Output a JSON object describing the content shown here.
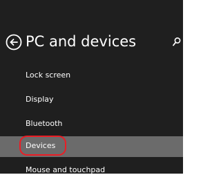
{
  "header": {
    "title": "PC and devices",
    "back_icon": "back-arrow-circle-icon",
    "search_icon": "search-icon"
  },
  "nav": {
    "items": [
      {
        "label": "Lock screen",
        "selected": false
      },
      {
        "label": "Display",
        "selected": false
      },
      {
        "label": "Bluetooth",
        "selected": false
      },
      {
        "label": "Devices",
        "selected": true
      },
      {
        "label": "Mouse and touchpad",
        "selected": false
      }
    ]
  },
  "colors": {
    "panel_background": "#1f1f1f",
    "selected_background": "#6b6b6b",
    "text": "#ffffff",
    "annotation": "#ec1c24"
  }
}
